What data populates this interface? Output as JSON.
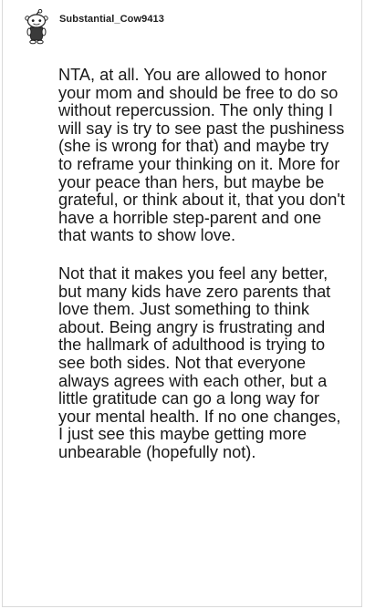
{
  "comment": {
    "author": "Substantial_Cow9413",
    "avatar_icon": "reddit-snoo-avatar-icon",
    "paragraphs": [
      "NTA, at all. You are allowed to honor your mom and should be free to do so without repercussion. The only thing I will say is try to see past the pushiness (she is wrong for that) and maybe try to reframe your thinking on it. More for your peace than hers, but maybe be grateful, or think about it, that you don't have a horrible step-parent and one that wants to show love.",
      "Not that it makes you feel any better, but many kids have zero parents that love them. Just something to think about. Being angry is frustrating and the hallmark of adulthood is trying to see both sides. Not that everyone always agrees with each other, but a little gratitude can go a long way for your mental health. If no one changes, I just see this maybe getting more unbearable (hopefully not)."
    ]
  }
}
